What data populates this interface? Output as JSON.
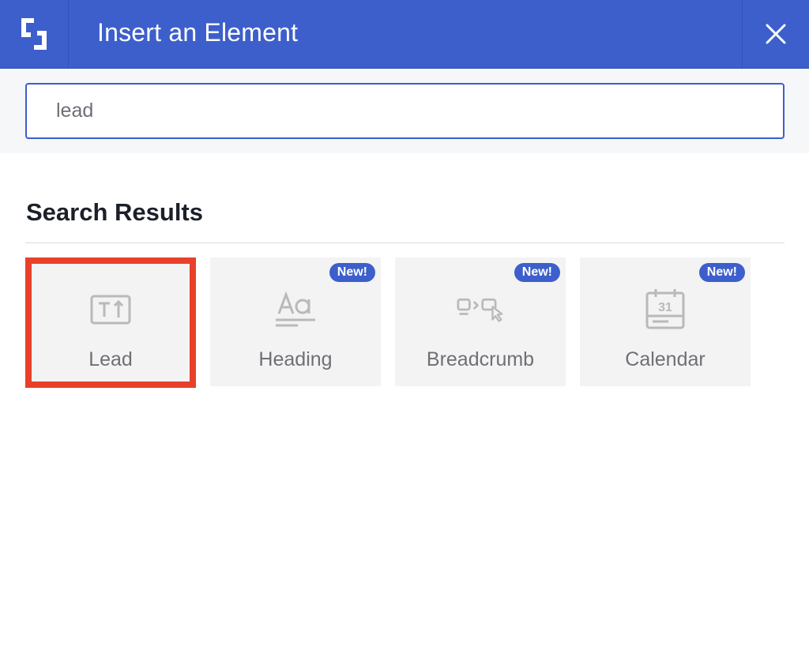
{
  "header": {
    "title": "Insert an Element",
    "logo_icon": "builder-logo-icon",
    "close_icon": "close-icon",
    "background": "#3d5fcc"
  },
  "search": {
    "value": "lead",
    "placeholder": ""
  },
  "results": {
    "title": "Search Results",
    "items": [
      {
        "label": "Lead",
        "icon": "lead-text-icon",
        "badge": "",
        "selected": true
      },
      {
        "label": "Heading",
        "icon": "heading-icon",
        "badge": "New!",
        "selected": false
      },
      {
        "label": "Breadcrumb",
        "icon": "breadcrumb-icon",
        "badge": "New!",
        "selected": false
      },
      {
        "label": "Calendar",
        "icon": "calendar-icon",
        "badge": "New!",
        "selected": false
      }
    ]
  },
  "colors": {
    "accent": "#3d5fcc",
    "selection": "#e8402a",
    "card_bg": "#f3f3f3"
  }
}
